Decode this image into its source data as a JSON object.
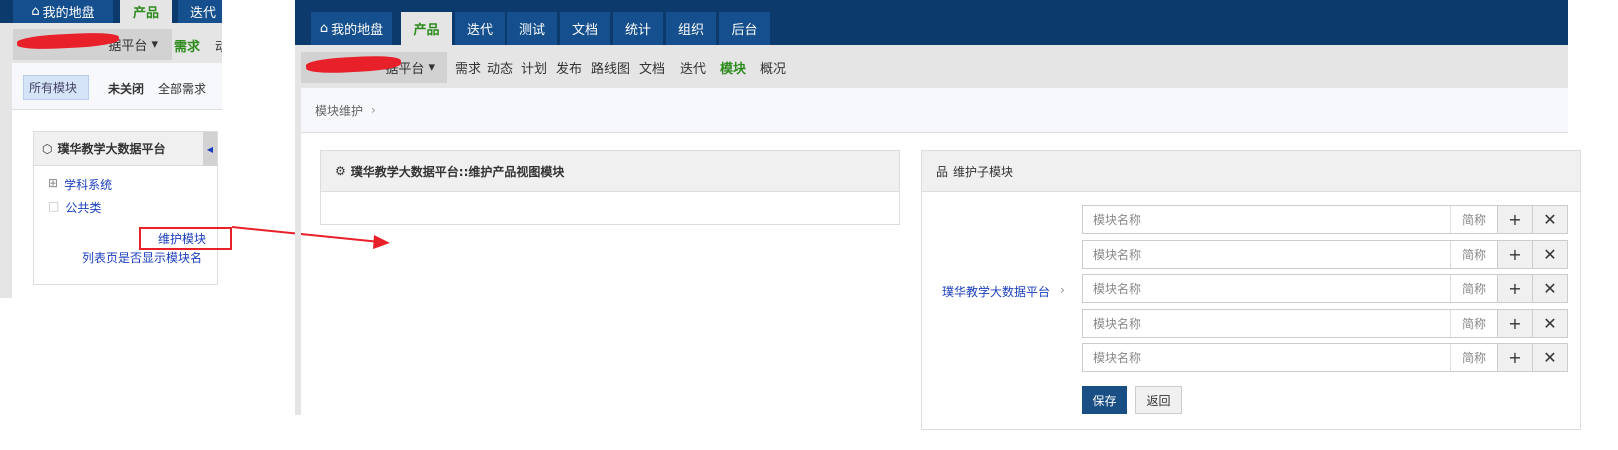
{
  "left": {
    "tabs": [
      {
        "label": "我的地盘",
        "icon": "home-icon"
      },
      {
        "label": "产品"
      },
      {
        "label": "迭代"
      }
    ],
    "product_dropdown": "据平台",
    "subnav": [
      "需求",
      "动"
    ],
    "breadcrumb": {
      "chip": "所有模块",
      "filters": [
        "未关闭",
        "全部需求"
      ]
    },
    "tree": {
      "title": "璞华教学大数据平台",
      "items": [
        "学科系统",
        "公共类"
      ],
      "maintain_link": "维护模块",
      "show_module_link": "列表页是否显示模块名"
    }
  },
  "right": {
    "tabs": [
      {
        "label": "我的地盘",
        "icon": "home-icon"
      },
      {
        "label": "产品"
      },
      {
        "label": "迭代"
      },
      {
        "label": "测试"
      },
      {
        "label": "文档"
      },
      {
        "label": "统计"
      },
      {
        "label": "组织"
      },
      {
        "label": "后台"
      }
    ],
    "product_dropdown": "据平台",
    "subnav": [
      "需求",
      "动态",
      "计划",
      "发布",
      "路线图",
      "文档",
      "迭代",
      "模块",
      "概况"
    ],
    "active_subnav": "模块",
    "breadcrumb": "模块维护",
    "view_panel_title": "璞华教学大数据平台::维护产品视图模块",
    "child_panel_title": "维护子模块",
    "parent_label": "璞华教学大数据平台",
    "rows": [
      {
        "placeholder": "模块名称",
        "abbr": "简称"
      },
      {
        "placeholder": "模块名称",
        "abbr": "简称"
      },
      {
        "placeholder": "模块名称",
        "abbr": "简称"
      },
      {
        "placeholder": "模块名称",
        "abbr": "简称"
      },
      {
        "placeholder": "模块名称",
        "abbr": "简称"
      }
    ],
    "save_label": "保存",
    "back_label": "返回"
  },
  "colors": {
    "topbar": "#0c3a6d",
    "tab": "#154f8e",
    "active_green": "#2e8b1e",
    "annotation_red": "#e8202a",
    "save": "#1a4f85"
  }
}
